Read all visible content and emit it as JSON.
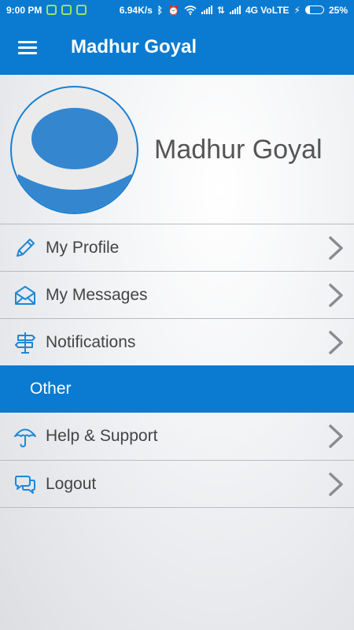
{
  "status_bar": {
    "time": "9:00 PM",
    "speed": "6.94K/s",
    "network": "4G VoLTE",
    "battery_percent": "25%",
    "battery_level": 0.25
  },
  "app_bar": {
    "title": "Madhur Goyal",
    "menu_icon": "hamburger-menu-icon"
  },
  "profile": {
    "name": "Madhur Goyal"
  },
  "menu": {
    "items": [
      {
        "label": "My Profile",
        "icon": "pencil-icon"
      },
      {
        "label": "My Messages",
        "icon": "envelope-icon"
      },
      {
        "label": "Notifications",
        "icon": "signpost-icon"
      }
    ],
    "section_header": "Other",
    "other_items": [
      {
        "label": "Help & Support",
        "icon": "umbrella-icon"
      },
      {
        "label": "Logout",
        "icon": "chat-bubbles-icon"
      }
    ]
  },
  "colors": {
    "primary": "#0a7bd0",
    "icon": "#1e88d8",
    "chevron": "#8a8c8f"
  }
}
